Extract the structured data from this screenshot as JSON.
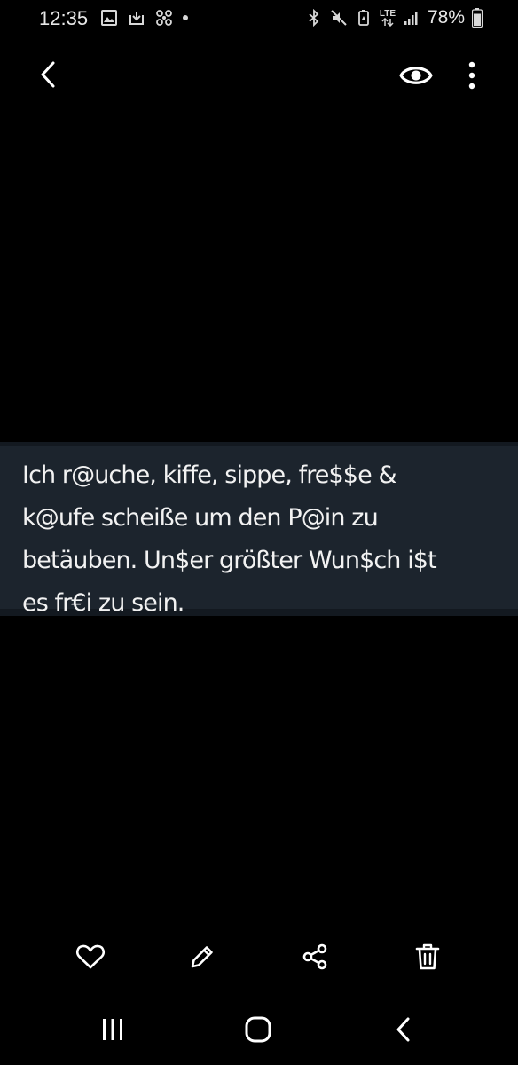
{
  "status_bar": {
    "time": "12:35",
    "battery_percent": "78%",
    "network_label": "LTE",
    "left_icons": [
      "gallery-icon",
      "download-icon",
      "pinwheel-icon",
      "notification-dot"
    ],
    "right_icons": [
      "bluetooth-icon",
      "mute-icon",
      "battery-saver-icon",
      "lte-icon",
      "signal-icon",
      "battery-icon"
    ]
  },
  "top_bar": {
    "back_icon": "chevron-left-icon",
    "view_icon": "eye-icon",
    "menu_icon": "more-vertical-icon"
  },
  "image": {
    "caption": "Ich r@uche, kiffe, sippe, fre$$e &\nk@ufe scheiße um den P@in zu\nbetäuben. Un$er größter Wun$ch i$t\nes fr€i zu sein.",
    "background_color": "#000000",
    "caption_band_color": "#1c242d"
  },
  "action_bar": {
    "items": [
      "heart-icon",
      "pencil-icon",
      "share-icon",
      "trash-icon"
    ]
  },
  "nav_bar": {
    "items": [
      "recent-apps-icon",
      "home-icon",
      "back-icon"
    ]
  }
}
